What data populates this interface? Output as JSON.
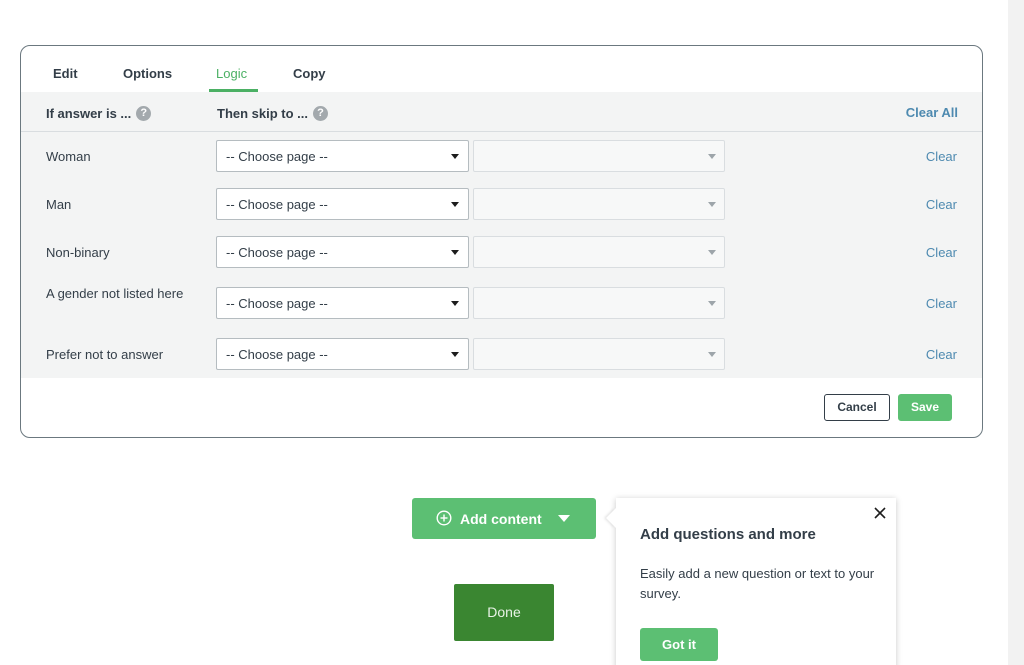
{
  "tabs": [
    {
      "label": "Edit",
      "active": false
    },
    {
      "label": "Options",
      "active": false
    },
    {
      "label": "Logic",
      "active": true
    },
    {
      "label": "Copy",
      "active": false
    }
  ],
  "logic": {
    "header_answer": "If answer is ...",
    "header_skip": "Then skip to ...",
    "help_glyph": "?",
    "clear_all": "Clear All",
    "rows": [
      {
        "answer": "Woman",
        "page_select": "-- Choose page --",
        "question_select": "",
        "clear": "Clear"
      },
      {
        "answer": "Man",
        "page_select": "-- Choose page --",
        "question_select": "",
        "clear": "Clear"
      },
      {
        "answer": "Non-binary",
        "page_select": "-- Choose page --",
        "question_select": "",
        "clear": "Clear"
      },
      {
        "answer": "A gender not listed here",
        "page_select": "-- Choose page --",
        "question_select": "",
        "clear": "Clear"
      },
      {
        "answer": "Prefer not to answer",
        "page_select": "-- Choose page --",
        "question_select": "",
        "clear": "Clear"
      }
    ]
  },
  "footer": {
    "cancel": "Cancel",
    "save": "Save"
  },
  "add_content": {
    "label": "Add content",
    "icon": "plus-circle-icon"
  },
  "done": "Done",
  "popover": {
    "title": "Add questions and more",
    "text": "Easily add a new question or text to your survey.",
    "button": "Got it"
  },
  "colors": {
    "accent_green": "#5cbf73",
    "dark_green": "#3a8631",
    "link_blue": "#4e8ab0",
    "text": "#333e48"
  }
}
